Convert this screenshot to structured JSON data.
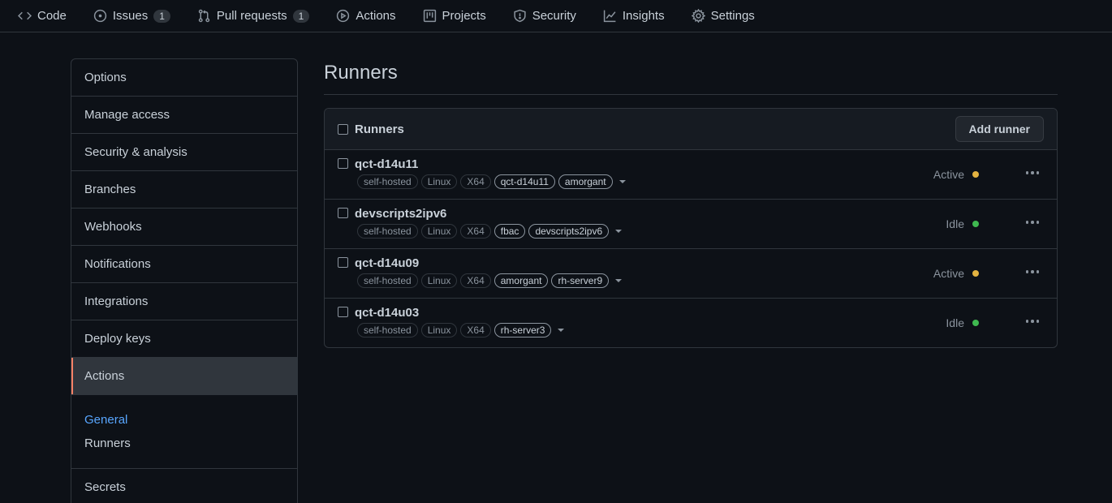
{
  "topnav": {
    "tabs": [
      {
        "label": "Code",
        "icon": "code-icon"
      },
      {
        "label": "Issues",
        "icon": "issue-icon",
        "count": "1"
      },
      {
        "label": "Pull requests",
        "icon": "pull-request-icon",
        "count": "1"
      },
      {
        "label": "Actions",
        "icon": "play-icon"
      },
      {
        "label": "Projects",
        "icon": "project-icon"
      },
      {
        "label": "Security",
        "icon": "shield-icon"
      },
      {
        "label": "Insights",
        "icon": "graph-icon"
      },
      {
        "label": "Settings",
        "icon": "gear-icon"
      }
    ]
  },
  "sidebar": {
    "items": [
      {
        "label": "Options"
      },
      {
        "label": "Manage access"
      },
      {
        "label": "Security & analysis"
      },
      {
        "label": "Branches"
      },
      {
        "label": "Webhooks"
      },
      {
        "label": "Notifications"
      },
      {
        "label": "Integrations"
      },
      {
        "label": "Deploy keys"
      },
      {
        "label": "Actions",
        "selected": true
      }
    ],
    "sub_items": [
      {
        "label": "General"
      },
      {
        "label": "Runners"
      }
    ],
    "after": [
      {
        "label": "Secrets"
      }
    ]
  },
  "main": {
    "title": "Runners",
    "header_label": "Runners",
    "add_button": "Add runner",
    "runners": [
      {
        "name": "qct-d14u11",
        "default_labels": [
          "self-hosted",
          "Linux",
          "X64"
        ],
        "custom_labels": [
          "qct-d14u11",
          "amorgant"
        ],
        "status": "Active"
      },
      {
        "name": "devscripts2ipv6",
        "default_labels": [
          "self-hosted",
          "Linux",
          "X64"
        ],
        "custom_labels": [
          "fbac",
          "devscripts2ipv6"
        ],
        "status": "Idle"
      },
      {
        "name": "qct-d14u09",
        "default_labels": [
          "self-hosted",
          "Linux",
          "X64"
        ],
        "custom_labels": [
          "amorgant",
          "rh-server9"
        ],
        "status": "Active"
      },
      {
        "name": "qct-d14u03",
        "default_labels": [
          "self-hosted",
          "Linux",
          "X64"
        ],
        "custom_labels": [
          "rh-server3"
        ],
        "status": "Idle"
      }
    ]
  },
  "colors": {
    "background": "#0d1117",
    "active_dot": "#e3b341",
    "idle_dot": "#3fb950",
    "link": "#58a6ff",
    "selected_accent": "#f78166"
  }
}
